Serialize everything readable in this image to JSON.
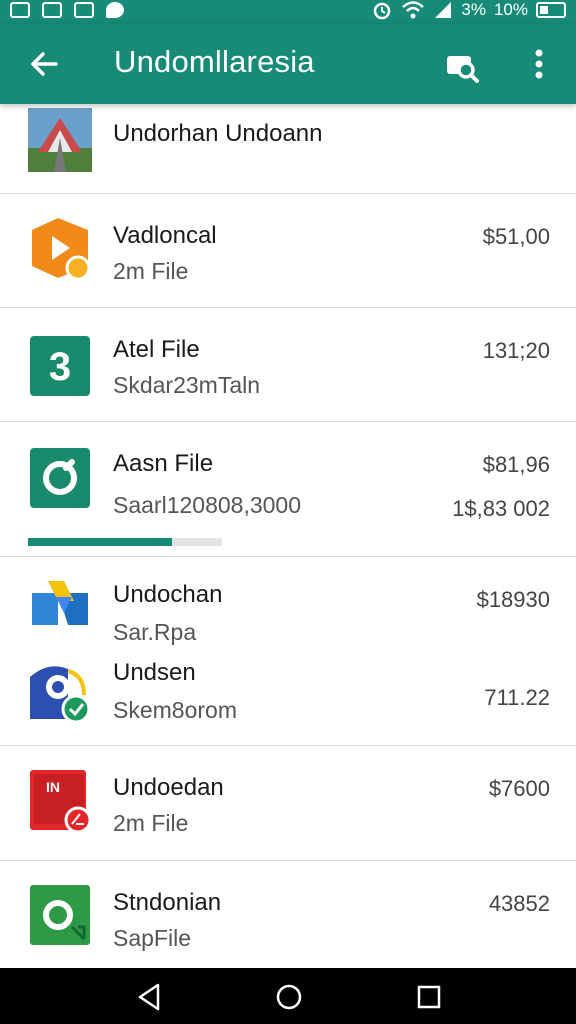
{
  "status_bar": {
    "battery_text": "10%",
    "signal_text": "3%",
    "icons": [
      "gallery-icon",
      "image-icon",
      "photo-icon",
      "bird-icon",
      "alarm-icon",
      "wifi-icon",
      "signal-icon",
      "battery-icon"
    ]
  },
  "app_bar": {
    "title": "Undomllaresia",
    "back_icon": "arrow-left-icon",
    "search_icon": "search-icon",
    "more_icon": "more-vert-icon"
  },
  "items": [
    {
      "name": "Undorhan Undoann",
      "sub": "",
      "price": "",
      "price2": "",
      "icon": "bridge-photo-icon"
    },
    {
      "name": "Vadloncal",
      "sub": "2m File",
      "price": "$51,00",
      "price2": "",
      "icon": "orange-play-icon"
    },
    {
      "name": "Atel File",
      "sub": "Skdar23mTaln",
      "price": "131;20",
      "price2": "",
      "icon": "green-3-icon"
    },
    {
      "name": "Aasn File",
      "sub": "Saarl120808,3000",
      "price": "$81,96",
      "price2": "1$,83 002",
      "icon": "green-compass-icon",
      "progress": 0.74
    },
    {
      "name": "Undochan",
      "sub": "Sar.Rpa",
      "price": "$18930",
      "price2": "",
      "icon": "blue-drive-icon"
    },
    {
      "name": "Undsen",
      "sub": "Skem8orom",
      "price": "711.22",
      "price2": "",
      "icon": "blue-checkmark-icon"
    },
    {
      "name": "Undoedan",
      "sub": "2m File",
      "price": "$7600",
      "price2": "",
      "icon": "red-file-icon"
    },
    {
      "name": "Stndonian",
      "sub": "SapFile",
      "price": "43852",
      "price2": "",
      "icon": "green-q-icon"
    }
  ],
  "nav_bar": {
    "back": "nav-back-icon",
    "home": "nav-home-icon",
    "recents": "nav-recents-icon"
  }
}
